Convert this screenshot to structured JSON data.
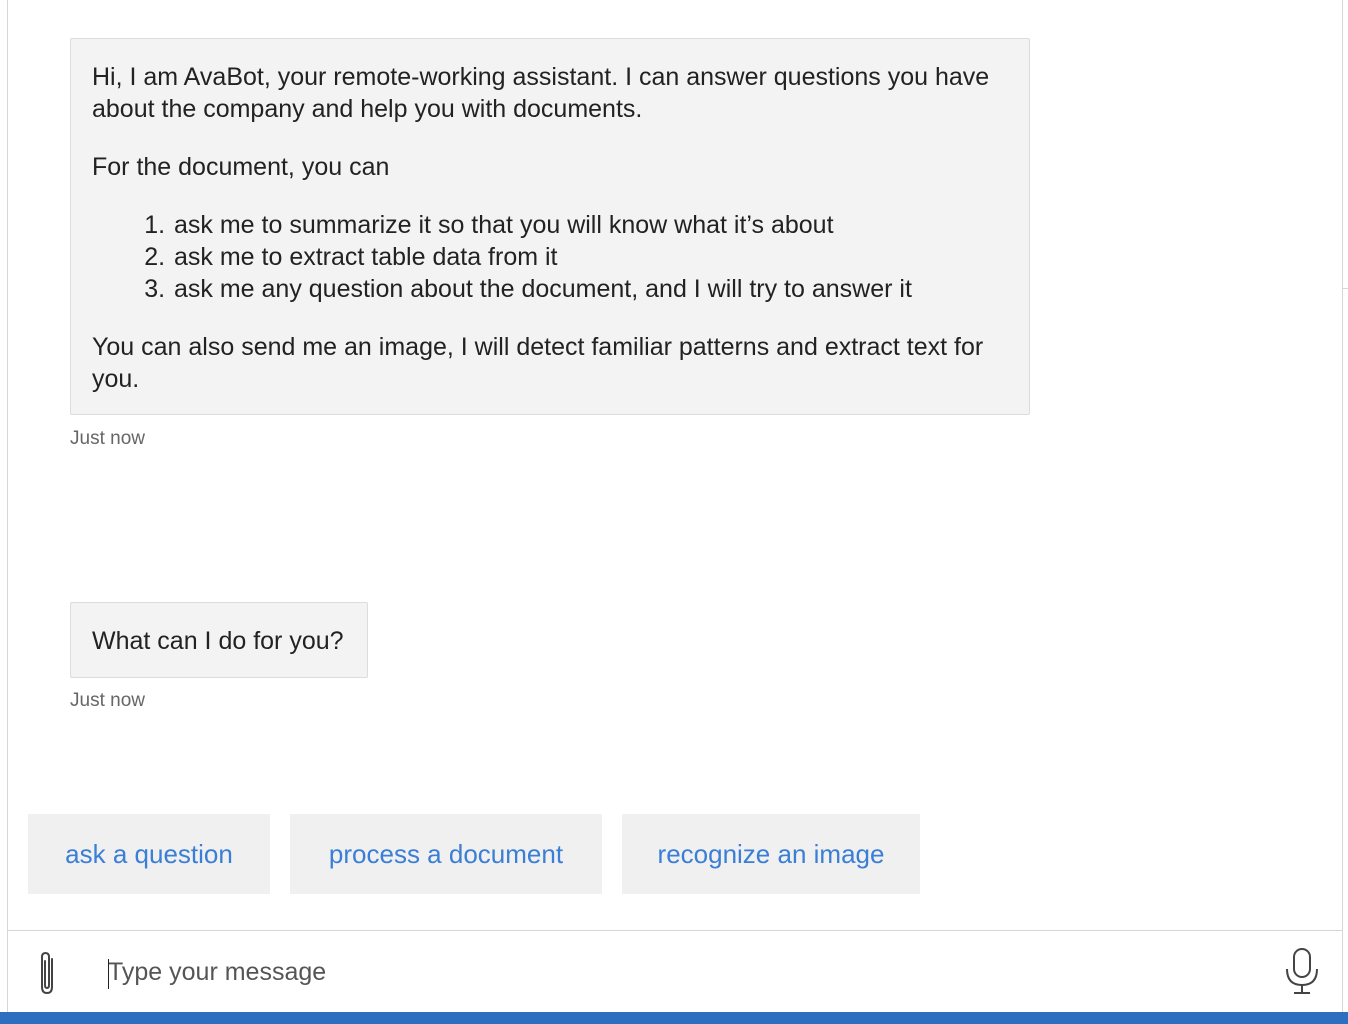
{
  "chat": {
    "messages": [
      {
        "intro": "Hi, I am AvaBot, your remote-working assistant. I can answer questions you have about the company and help you with documents.",
        "lead": "For the document, you can",
        "list": [
          "ask me to summarize it so that you will know what it’s about",
          "ask me to extract table data from it",
          "ask me any question about the document, and I will try to answer it"
        ],
        "outro": "You can also send me an image, I will detect familiar patterns and extract text for you.",
        "timestamp": "Just now"
      },
      {
        "text": "What can I do for you?",
        "timestamp": "Just now"
      }
    ]
  },
  "suggested_actions": [
    "ask a question",
    "process a document",
    "recognize an image"
  ],
  "input": {
    "placeholder": "Type your message"
  },
  "icons": {
    "attach": "paperclip-icon",
    "microphone": "microphone-icon"
  },
  "colors": {
    "accent": "#2d6ec0",
    "action_text": "#3a7ed6",
    "bubble_bg": "#f3f3f3"
  }
}
